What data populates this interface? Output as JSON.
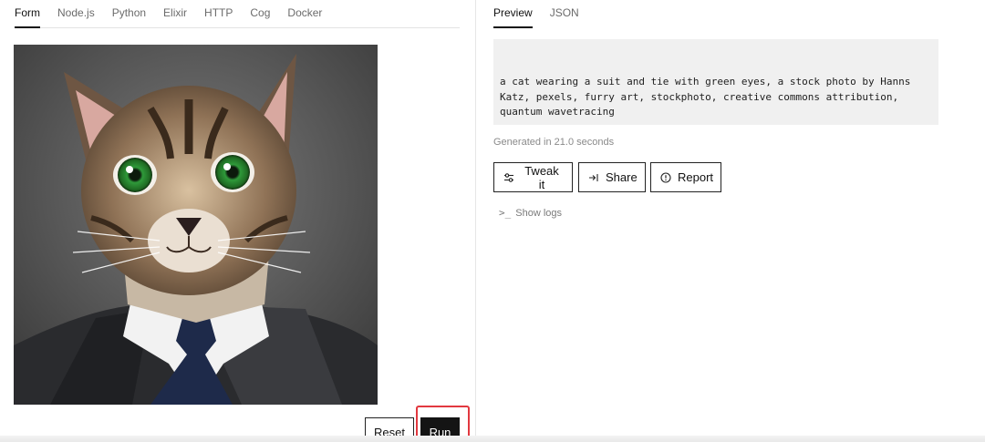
{
  "left_tabs": [
    "Form",
    "Node.js",
    "Python",
    "Elixir",
    "HTTP",
    "Cog",
    "Docker"
  ],
  "right_tabs": [
    "Preview",
    "JSON"
  ],
  "output": {
    "text": "a cat wearing a suit and tie with green eyes, a stock photo by Hanns Katz, pexels, furry art, stockphoto, creative commons attribution, quantum wavetracing",
    "generated": "Generated in 21.0 seconds"
  },
  "actions": {
    "tweak": "Tweak it",
    "share": "Share",
    "report": "Report",
    "show_logs": "Show logs"
  },
  "form_buttons": {
    "reset": "Reset",
    "run": "Run"
  },
  "icons": {
    "tweak": "sliders-icon",
    "share": "share-icon",
    "report": "info-circle-icon",
    "logs": "terminal-icon"
  },
  "colors": {
    "highlight": "#e2383f",
    "run_bg": "#141414",
    "output_bg": "#f0f0f0"
  }
}
